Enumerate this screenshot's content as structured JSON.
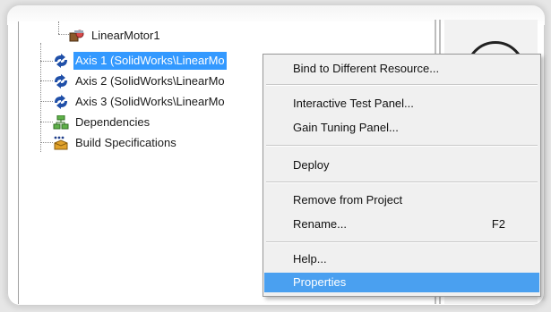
{
  "tree": {
    "items": [
      {
        "label": "LinearMotor1",
        "icon": "linear-motor-icon"
      },
      {
        "label": "Axis 1 (SolidWorks\\LinearMo",
        "icon": "axis-icon",
        "selected": true
      },
      {
        "label": "Axis 2 (SolidWorks\\LinearMo",
        "icon": "axis-icon"
      },
      {
        "label": "Axis 3 (SolidWorks\\LinearMo",
        "icon": "axis-icon"
      },
      {
        "label": "Dependencies",
        "icon": "dependencies-icon"
      },
      {
        "label": "Build Specifications",
        "icon": "build-specifications-icon"
      }
    ]
  },
  "context_menu": {
    "items": [
      {
        "label": "Bind to Different Resource..."
      },
      {
        "label": "Interactive Test Panel..."
      },
      {
        "label": "Gain Tuning Panel..."
      },
      {
        "label": "Deploy"
      },
      {
        "label": "Remove from Project"
      },
      {
        "label": "Rename...",
        "shortcut": "F2"
      },
      {
        "label": "Help..."
      },
      {
        "label": "Properties",
        "highlighted": true
      }
    ]
  },
  "colors": {
    "selection": "#3399ff",
    "menu_highlight": "#4aa0f0",
    "menu_background": "#f0f0f0"
  }
}
